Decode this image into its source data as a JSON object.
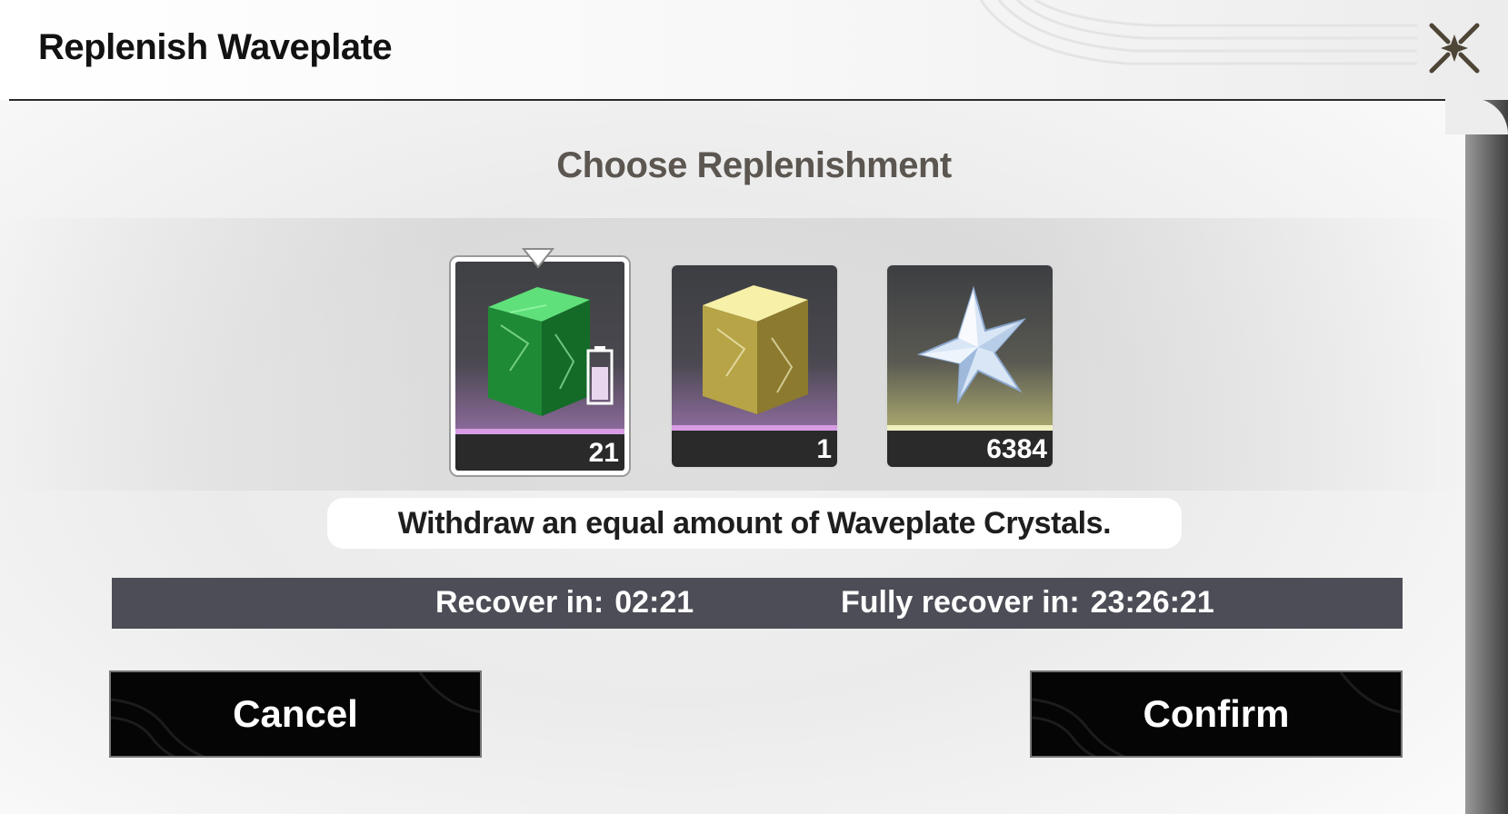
{
  "dialog": {
    "title": "Replenish Waveplate",
    "subtitle": "Choose Replenishment",
    "description": "Withdraw an equal amount of Waveplate Crystals."
  },
  "items": [
    {
      "name": "waveplate-crystal-green",
      "count": "21",
      "selected": true,
      "stripe_color": "#d79ce4"
    },
    {
      "name": "waveplate-crystal-gold",
      "count": "1",
      "selected": false,
      "stripe_color": "#d79ce4"
    },
    {
      "name": "astrite-star",
      "count": "6384",
      "selected": false,
      "stripe_color": "#f0efc0"
    }
  ],
  "timer": {
    "recover_label": "Recover in:",
    "recover_value": "02:21",
    "full_label": "Fully recover in:",
    "full_value": "23:26:21"
  },
  "buttons": {
    "cancel": "Cancel",
    "confirm": "Confirm"
  },
  "icons": {
    "close": "close-x-icon",
    "battery": "battery-icon"
  },
  "colors": {
    "timer_bg": "#4c4d56",
    "button_bg": "#050505",
    "title": "#121212",
    "subtitle": "#5b5650"
  }
}
